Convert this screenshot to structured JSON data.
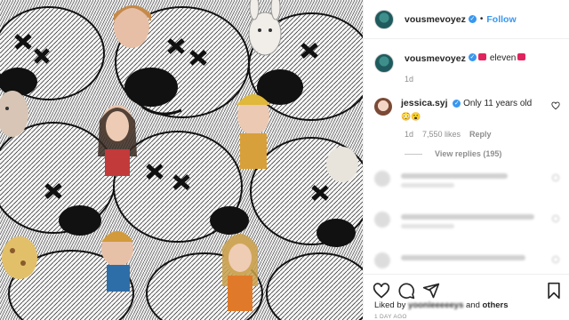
{
  "post": {
    "author": "vousmevoyez",
    "follow_label": "Follow",
    "separator": "•",
    "caption_text": "eleven",
    "caption_time": "1d"
  },
  "comment": {
    "author": "jessica.syj",
    "text": "Only 11 years old",
    "emoji_note": "😳😮",
    "time": "1d",
    "likes": "7,550 likes",
    "reply_label": "Reply",
    "view_replies": "View replies (195)"
  },
  "footer": {
    "liked_prefix": "Liked by ",
    "liked_name": "yoonieeeeeys",
    "liked_and": " and ",
    "liked_others": "others",
    "time_ago": "1 DAY AGO"
  },
  "colors": {
    "accent": "#3897f0",
    "heart_emoji": "#e0245e",
    "muted": "#8e8e8e"
  },
  "icons": [
    "heart-icon",
    "comment-icon",
    "share-icon",
    "bookmark-icon",
    "verified-icon"
  ]
}
